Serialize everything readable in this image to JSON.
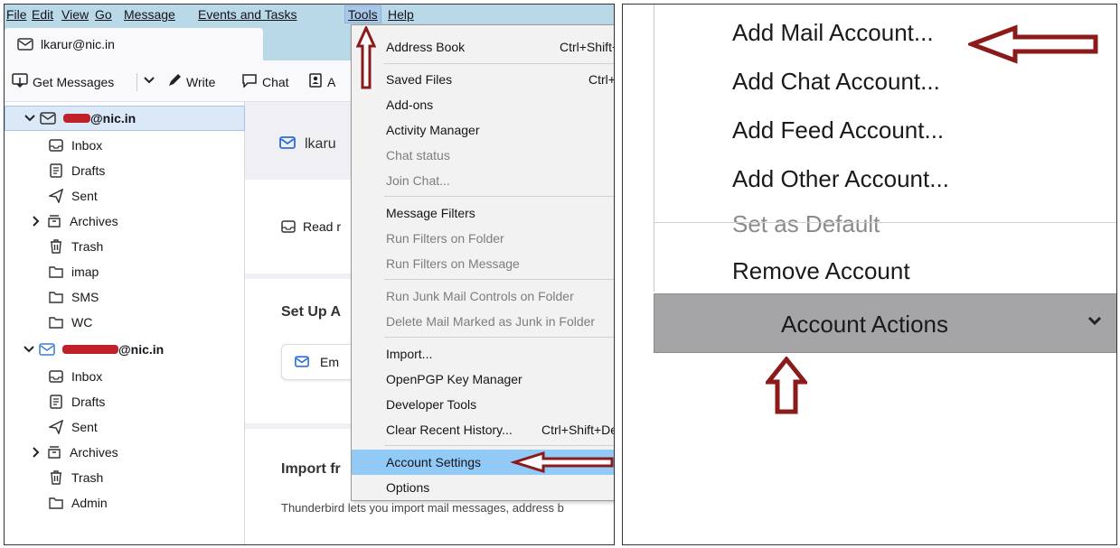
{
  "menubar": {
    "items": [
      "File",
      "Edit",
      "View",
      "Go",
      "Message",
      "Events and Tasks",
      "Tools",
      "Help"
    ]
  },
  "tab": {
    "label": "lkarur@nic.in"
  },
  "toolbar": {
    "get_messages": "Get Messages",
    "write": "Write",
    "chat": "Chat",
    "address_book_partial": "A"
  },
  "folders": {
    "account1": "@nic.in",
    "account2": "@nic.in",
    "items1": [
      "Inbox",
      "Drafts",
      "Sent",
      "Archives",
      "Trash",
      "imap",
      "SMS",
      "WC"
    ],
    "items2": [
      "Inbox",
      "Drafts",
      "Sent",
      "Archives",
      "Trash",
      "Admin"
    ]
  },
  "content": {
    "account_header": "lkaru",
    "read_label": "Read r",
    "setup_heading": "Set Up A",
    "email_button": "Em",
    "import_heading": "Import fr",
    "import_desc": "Thunderbird lets you import mail messages, address b"
  },
  "tools_menu": {
    "items": [
      {
        "label": "Address Book",
        "shortcut": "Ctrl+Shift+",
        "disabled": false
      },
      {
        "label": "Saved Files",
        "shortcut": "Ctrl+",
        "disabled": false
      },
      {
        "label": "Add-ons",
        "shortcut": "",
        "disabled": false
      },
      {
        "label": "Activity Manager",
        "shortcut": "",
        "disabled": false
      },
      {
        "label": "Chat status",
        "shortcut": "",
        "disabled": true
      },
      {
        "label": "Join Chat...",
        "shortcut": "",
        "disabled": true
      },
      {
        "label": "Message Filters",
        "shortcut": "",
        "disabled": false
      },
      {
        "label": "Run Filters on Folder",
        "shortcut": "",
        "disabled": true
      },
      {
        "label": "Run Filters on Message",
        "shortcut": "",
        "disabled": true
      },
      {
        "label": "Run Junk Mail Controls on Folder",
        "shortcut": "",
        "disabled": true
      },
      {
        "label": "Delete Mail Marked as Junk in Folder",
        "shortcut": "",
        "disabled": true
      },
      {
        "label": "Import...",
        "shortcut": "",
        "disabled": false
      },
      {
        "label": "OpenPGP Key Manager",
        "shortcut": "",
        "disabled": false
      },
      {
        "label": "Developer Tools",
        "shortcut": "",
        "disabled": false
      },
      {
        "label": "Clear Recent History...",
        "shortcut": "Ctrl+Shift+De",
        "disabled": false
      },
      {
        "label": "Account Settings",
        "shortcut": "",
        "disabled": false
      },
      {
        "label": "Options",
        "shortcut": "",
        "disabled": false
      }
    ]
  },
  "account_actions": {
    "items": [
      "Add Mail Account...",
      "Add Chat Account...",
      "Add Feed Account...",
      "Add Other Account...",
      "Set as Default",
      "Remove Account"
    ],
    "button_label": "Account Actions"
  },
  "colors": {
    "menubar_bg": "#b9d8e8",
    "highlight": "#91c9f7",
    "arrow": "#8b1a1a",
    "redaction": "#c0202a",
    "account_actions_bg": "#a5a5a8"
  }
}
